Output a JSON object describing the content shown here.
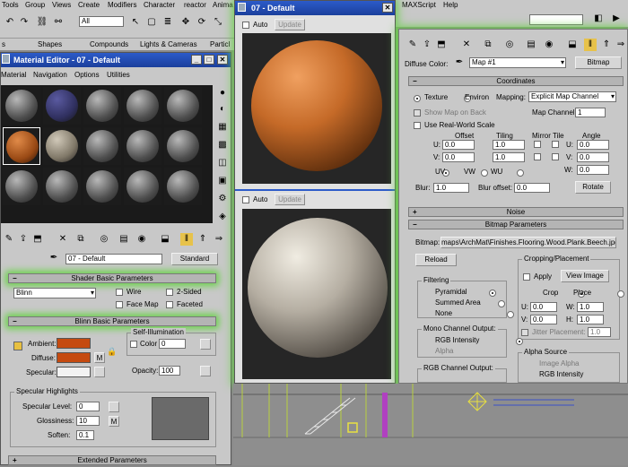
{
  "menubar": {
    "items": [
      "Tools",
      "Group",
      "Views",
      "Create",
      "Modifiers",
      "Character",
      "reactor",
      "Anima"
    ],
    "filter_value": "All",
    "right_items": [
      "MAXScript",
      "Help"
    ]
  },
  "tabs": [
    "s",
    "Shapes",
    "Compounds",
    "Lights & Cameras",
    "Particl"
  ],
  "material_editor": {
    "title": "Material Editor - 07 - Default",
    "menu": [
      "Material",
      "Navigation",
      "Options",
      "Utilities"
    ],
    "material_name": "07 - Default",
    "type_button": "Standard",
    "shader_rollout": "Shader Basic Parameters",
    "shader_value": "Blinn",
    "wire": "Wire",
    "two_sided": "2-Sided",
    "face_map": "Face Map",
    "faceted": "Faceted",
    "blinn_rollout": "Blinn Basic Parameters",
    "self_illum": "Self-Illumination",
    "ambient": "Ambient:",
    "diffuse": "Diffuse:",
    "specular": "Specular:",
    "color": "Color",
    "color_value": "0",
    "opacity": "Opacity:",
    "opacity_value": "100",
    "lock_m": "M",
    "spec_highlights": "Specular Highlights",
    "spec_level": "Specular Level:",
    "spec_level_value": "0",
    "glossiness": "Glossiness:",
    "glossiness_value": "10",
    "soften": "Soften:",
    "soften_value": "0.1",
    "extended_rollout": "Extended Parameters",
    "ambient_color": "#c54a10",
    "diffuse_color": "#c54a10",
    "specular_color": "#f2f2f2"
  },
  "preview_window": {
    "title": "07 - Default",
    "auto": "Auto",
    "update": "Update"
  },
  "map_panel": {
    "diffuse_color": "Diffuse Color:",
    "map_name": "Map #1",
    "bitmap_btn": "Bitmap",
    "coordinates_rollout": "Coordinates",
    "texture": "Texture",
    "environ": "Environ",
    "mapping": "Mapping:",
    "mapping_value": "Explicit Map Channel",
    "show_map_on_back": "Show Map on Back",
    "map_channel": "Map Channel:",
    "map_channel_value": "1",
    "use_real_world": "Use Real-World Scale",
    "offset": "Offset",
    "tiling": "Tiling",
    "mirror_tile": "Mirror Tile",
    "angle": "Angle",
    "u": "U:",
    "v": "V:",
    "w": "W:",
    "u_offset": "0.0",
    "v_offset": "0.0",
    "u_tiling": "1.0",
    "v_tiling": "1.0",
    "u_angle": "0.0",
    "v_angle": "0.0",
    "w_angle": "0.0",
    "uv": "UV",
    "vw": "VW",
    "wu": "WU",
    "blur": "Blur:",
    "blur_value": "1.0",
    "blur_offset": "Blur offset:",
    "blur_offset_value": "0.0",
    "rotate": "Rotate",
    "noise_rollout": "Noise",
    "bitmap_rollout": "Bitmap Parameters",
    "bitmap_label": "Bitmap:",
    "bitmap_path": "maps\\ArchMat\\Finishes.Flooring.Wood.Plank.Beech.jpg",
    "reload": "Reload",
    "cropping": "Cropping/Placement",
    "apply": "Apply",
    "view_image": "View Image",
    "crop": "Crop",
    "place": "Place",
    "crop_u": "0.0",
    "crop_v": "0.0",
    "crop_w": "1.0",
    "crop_h": "1.0",
    "h": "H:",
    "jitter": "Jitter Placement:",
    "jitter_value": "1.0",
    "filtering": "Filtering",
    "pyramidal": "Pyramidal",
    "summed_area": "Summed Area",
    "none": "None",
    "mono_output": "Mono Channel Output:",
    "rgb_intensity": "RGB Intensity",
    "alpha": "Alpha",
    "rgb_output": "RGB Channel Output:",
    "alpha_source": "Alpha Source",
    "image_alpha": "Image Alpha",
    "rgb_intensity2": "RGB Intensity"
  }
}
